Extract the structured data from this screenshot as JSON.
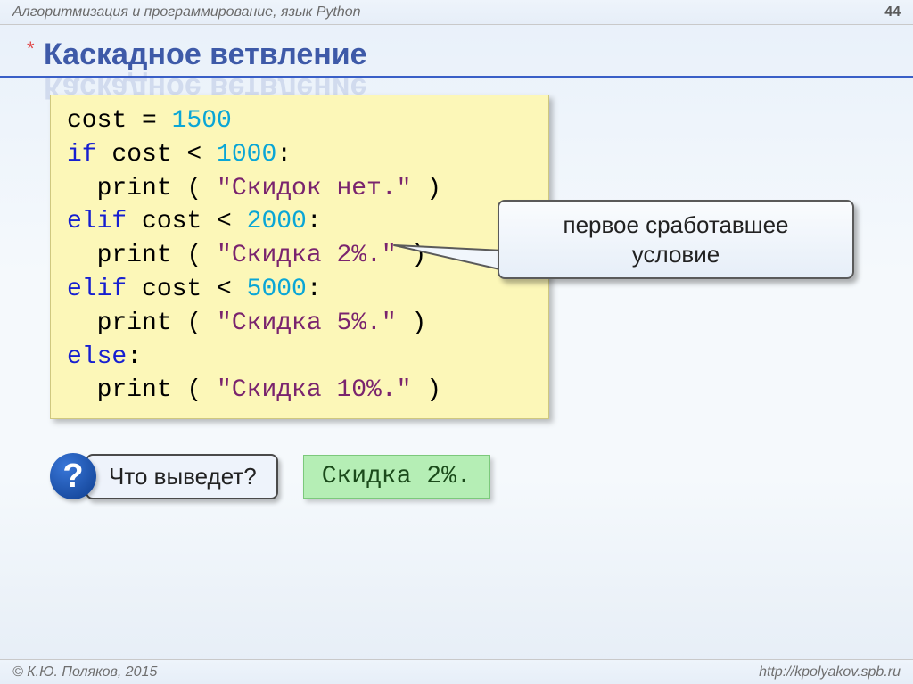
{
  "header": {
    "course": "Алгоритмизация и программирование, язык Python",
    "page": "44"
  },
  "title": {
    "asterisk": "*",
    "text": "Каскадное ветвление"
  },
  "code": {
    "l1_a": "cost = ",
    "l1_num": "1500",
    "l2_kw": "if",
    "l2_a": " cost < ",
    "l2_num": "1000",
    "l2_b": ":",
    "l3_a": "  print ( ",
    "l3_str": "\"Скидок нет.\"",
    "l3_b": " )",
    "l4_kw": "elif",
    "l4_a": " cost < ",
    "l4_num": "2000",
    "l4_b": ":",
    "l5_a": "  print ( ",
    "l5_str": "\"Скидка 2%.\"",
    "l5_b": " )",
    "l6_kw": "elif",
    "l6_a": " cost < ",
    "l6_num": "5000",
    "l6_b": ":",
    "l7_a": "  print ( ",
    "l7_str": "\"Скидка 5%.\"",
    "l7_b": " )",
    "l8_kw": "else",
    "l8_a": ":",
    "l9_a": "  print ( ",
    "l9_str": "\"Скидка 10%.\"",
    "l9_b": " )"
  },
  "callout": {
    "line1": "первое сработавшее",
    "line2": "условие"
  },
  "question": {
    "mark": "?",
    "text": "Что выведет?",
    "answer": "Скидка 2%."
  },
  "footer": {
    "left": "© К.Ю. Поляков, 2015",
    "right": "http://kpolyakov.spb.ru"
  }
}
